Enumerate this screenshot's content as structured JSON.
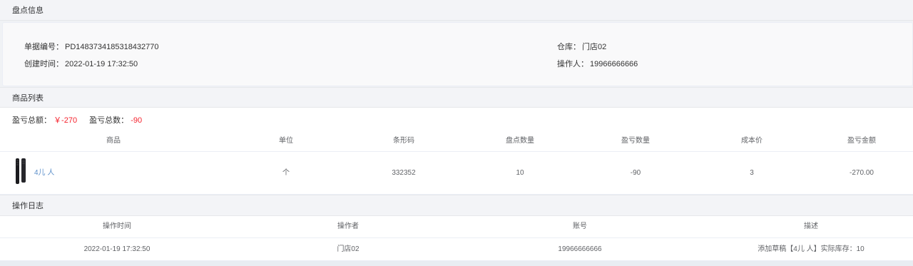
{
  "inventory_info": {
    "section_title": "盘点信息",
    "doc_no_label": "单据编号：",
    "doc_no": "PD1483734185318432770",
    "created_label": "创建时间：",
    "created": "2022-01-19 17:32:50",
    "warehouse_label": "仓库：",
    "warehouse": "门店02",
    "operator_label": "操作人：",
    "operator": "19966666666"
  },
  "product_list": {
    "section_title": "商品列表",
    "loss_amount_label": "盈亏总额：",
    "loss_amount": "￥-270",
    "loss_count_label": "盈亏总数：",
    "loss_count": "-90",
    "columns": [
      "商品",
      "单位",
      "条形码",
      "盘点数量",
      "盈亏数量",
      "成本价",
      "盈亏金额"
    ],
    "rows": [
      {
        "image_icon": "hair-comb-image",
        "product": "4儿 人",
        "unit": "个",
        "barcode": "332352",
        "count_qty": "10",
        "loss_qty": "-90",
        "cost": "3",
        "loss_amount": "-270.00"
      }
    ]
  },
  "op_log": {
    "section_title": "操作日志",
    "columns": [
      "操作时间",
      "操作者",
      "账号",
      "描述"
    ],
    "rows": [
      {
        "time": "2022-01-19 17:32:50",
        "operator": "门店02",
        "account": "19966666666",
        "description": "添加草稿【4儿 人】实际库存：10"
      }
    ]
  },
  "colors": {
    "accent_red": "#f5222d",
    "link_blue": "#5a8ec9",
    "header_bg": "#f3f4f7"
  }
}
